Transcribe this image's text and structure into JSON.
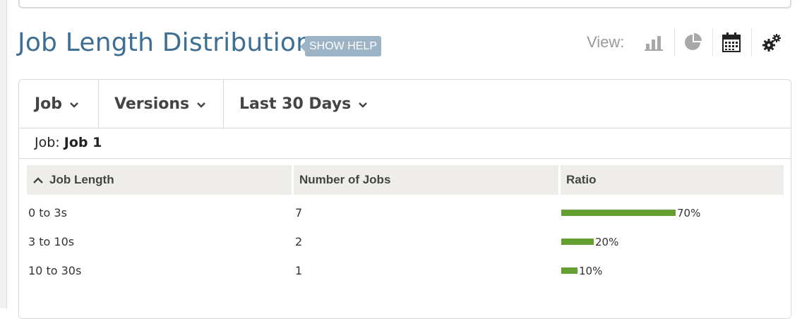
{
  "page": {
    "title": "Job Length Distribution",
    "help_label": "SHOW HELP"
  },
  "view": {
    "label": "View:",
    "icons": [
      "bar-chart-icon",
      "pie-chart-icon",
      "calendar-icon",
      "gear-icon"
    ]
  },
  "filters": {
    "job_label": "Job",
    "versions_label": "Versions",
    "range_label": "Last 30 Days"
  },
  "job_selection": {
    "prefix": "Job:",
    "value": "Job 1"
  },
  "table": {
    "columns": [
      "Job Length",
      "Number of Jobs",
      "Ratio"
    ],
    "rows": [
      {
        "length": "0 to 3s",
        "count": "7",
        "ratio_label": "70%",
        "ratio": 0.7
      },
      {
        "length": "3 to 10s",
        "count": "2",
        "ratio_label": "20%",
        "ratio": 0.2
      },
      {
        "length": "10 to 30s",
        "count": "1",
        "ratio_label": "10%",
        "ratio": 0.1
      }
    ]
  },
  "colors": {
    "title": "#3d6e93",
    "help_badge": "#9db3c6",
    "ratio_bar": "#64a031",
    "header_bg": "#eeedea"
  }
}
